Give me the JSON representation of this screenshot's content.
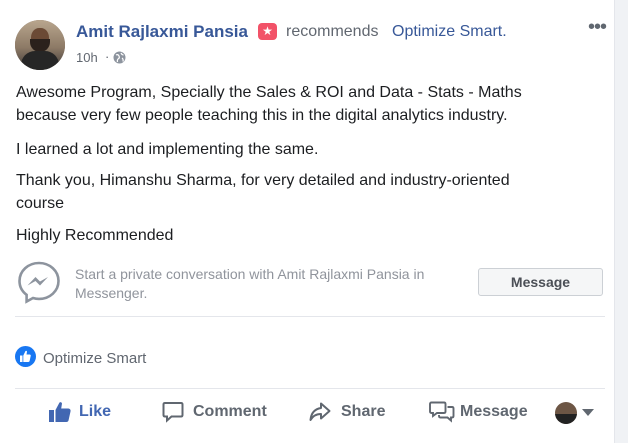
{
  "post": {
    "author": "Amit Rajlaxmi Pansia",
    "badge_icon": "star-icon",
    "recommends": "recommends",
    "page_name": "Optimize Smart.",
    "time": "10h",
    "time_separator": "·",
    "privacy_icon": "globe-icon",
    "more_icon": "more-options-icon",
    "more_glyph": "•••",
    "paragraphs": [
      "Awesome Program, Specially the Sales & ROI and Data - Stats - Maths",
      "because very few people teaching this in the digital analytics industry.",
      "I learned a lot and implementing the same.",
      "Thank you, Himanshu Sharma, for very detailed and industry-oriented",
      "course",
      "Highly Recommended"
    ]
  },
  "messenger": {
    "prompt_line1": "Start a private conversation with Amit Rajlaxmi Pansia in",
    "prompt_line2": "Messenger.",
    "button_label": "Message",
    "icon": "messenger-icon"
  },
  "reactions": {
    "icon": "like-icon",
    "text": "Optimize Smart"
  },
  "actions": [
    {
      "label": "Like",
      "icon": "thumbs-up-icon"
    },
    {
      "label": "Comment",
      "icon": "comment-icon"
    },
    {
      "label": "Share",
      "icon": "share-icon"
    },
    {
      "label": "Message",
      "icon": "message-icon"
    }
  ],
  "colors": {
    "link": "#385898",
    "like_active": "#4267b2",
    "brand_blue": "#1877f2",
    "badge": "#f25268",
    "muted": "#616770",
    "text": "#1c1e21"
  }
}
